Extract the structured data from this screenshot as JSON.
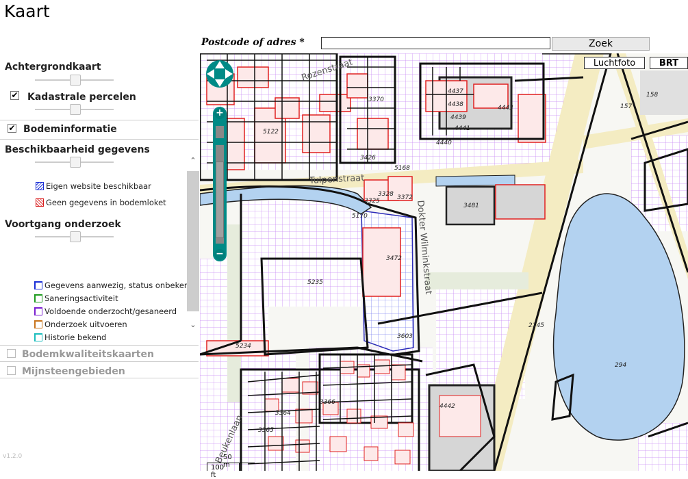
{
  "page": {
    "title": "Kaart"
  },
  "search": {
    "label": "Postcode of adres *",
    "value": "",
    "placeholder": "",
    "button": "Zoek"
  },
  "map_toggles": {
    "aerial": "Luchtfoto",
    "brt": "BRT"
  },
  "sidebar": {
    "background_map": {
      "title": "Achtergrondkaart"
    },
    "cadastral": {
      "label": "Kadastrale percelen",
      "checked": true,
      "check_glyph": "✔"
    },
    "soil_info": {
      "label": "Bodeminformatie",
      "checked": true,
      "check_glyph": "✔"
    },
    "availability": {
      "title": "Beschikbaarheid gegevens",
      "legend": [
        {
          "label": "Eigen website beschikbaar",
          "color": "#1a2fd6"
        },
        {
          "label": "Geen gegevens in bodemloket",
          "color": "#d81b1b"
        }
      ]
    },
    "progress": {
      "title": "Voortgang onderzoek",
      "legend": [
        {
          "label": "Gegevens aanwezig, status onbekend",
          "color": "#1a2fd6"
        },
        {
          "label": "Saneringsactiviteit",
          "color": "#1e9b1e"
        },
        {
          "label": "Voldoende onderzocht/gesaneerd",
          "color": "#7a1fd0"
        },
        {
          "label": "Onderzoek uitvoeren",
          "color": "#c8741b"
        },
        {
          "label": "Historie bekend",
          "color": "#1bbdbd"
        }
      ]
    },
    "soil_quality_maps": {
      "label": "Bodemkwaliteitskaarten",
      "checked": false
    },
    "mine_areas": {
      "label": "Mijnsteengebieden",
      "checked": false
    },
    "version": "v1.2.0"
  },
  "map": {
    "streets": [
      "Rozenstraat",
      "Tulpenstraat",
      "Dokter Wilminkstraat",
      "Beukenlaan"
    ],
    "parcel_numbers": [
      "3370",
      "4437",
      "4438",
      "4439",
      "4443",
      "4440",
      "4441",
      "158",
      "157",
      "5122",
      "3426",
      "5168",
      "3325",
      "3328",
      "3372",
      "5170",
      "3481",
      "3472",
      "5235",
      "3603",
      "5234",
      "2145",
      "294",
      "4442",
      "3365",
      "3364",
      "3366"
    ],
    "scale_m": "50 m",
    "scale_ft": "100 ft"
  },
  "colors": {
    "water": "#b3d2f0",
    "road": "#f4ecc2",
    "parcel_purple": "#b45ff0",
    "building_red": "#e02020",
    "zoom": "#008a86"
  }
}
